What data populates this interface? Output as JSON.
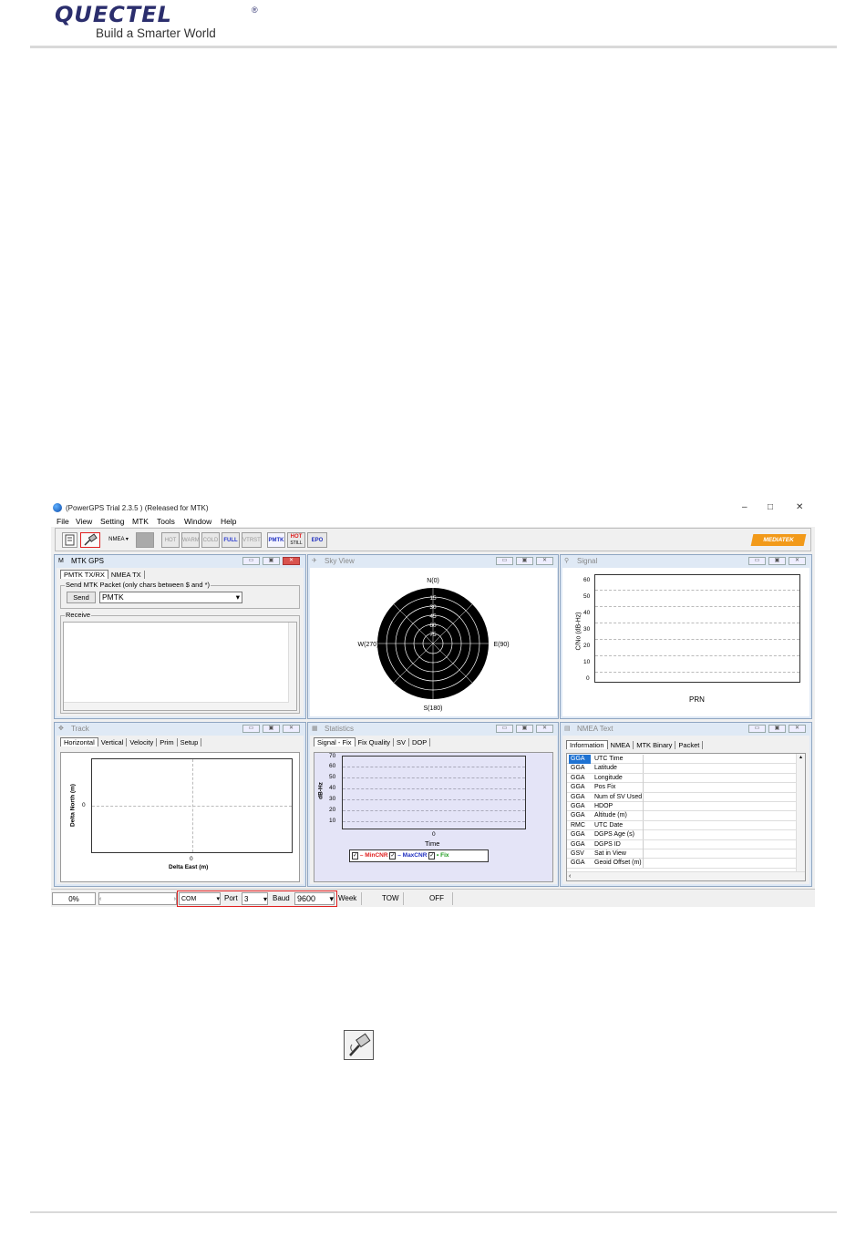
{
  "header": {
    "logo_word": "QUECTEL",
    "logo_reg": "®",
    "tagline": "Build a Smarter World"
  },
  "app": {
    "title": "(PowerGPS Trial 2.3.5 ) (Released for MTK)",
    "window_controls": [
      "–",
      "□",
      "✕"
    ],
    "menu": [
      "File",
      "View",
      "Setting",
      "MTK",
      "Tools",
      "Window",
      "Help"
    ],
    "toolbar": {
      "nmea": "NMEA",
      "hot": "HOT",
      "warm": "WARM",
      "cold": "COLD",
      "full": "FULL",
      "vtrst": "VTRST",
      "pmtk": "PMTK",
      "hot_still": "HOT",
      "still": "STILL",
      "epo": "EPO",
      "brand": "MEDIATEK"
    },
    "mtk_gps": {
      "title": "MTK GPS",
      "tabs": [
        "PMTK TX/RX",
        "NMEA TX"
      ],
      "send_group": "Send MTK Packet (only chars between $ and *)",
      "send_button": "Send",
      "packet_value": "PMTK",
      "receive_group": "Receive"
    },
    "sky_view": {
      "title": "Sky View",
      "north": "N(0)",
      "east": "E(90)",
      "south": "S(180)",
      "west": "W(270)",
      "rings": [
        "15",
        "30",
        "45",
        "60",
        "75"
      ]
    },
    "signal": {
      "title": "Signal",
      "ylabel": "C/No (dB-Hz)",
      "xlabel": "PRN",
      "yticks": [
        "60",
        "50",
        "40",
        "30",
        "20",
        "10",
        "0"
      ]
    },
    "track": {
      "title": "Track",
      "tabs": [
        "Horizontal",
        "Vertical",
        "Velocity",
        "Prim",
        "Setup"
      ],
      "ylabel": "Delta North (m)",
      "xlabel": "Delta East (m)",
      "zero_x": "0",
      "zero_y": "0"
    },
    "statistics": {
      "title": "Statistics",
      "tabs": [
        "Signal - Fix",
        "Fix Quality",
        "SV",
        "DOP"
      ],
      "ylabel": "dB-Hz",
      "xlabel": "Time",
      "zero_x": "0",
      "yticks": [
        "70",
        "60",
        "50",
        "40",
        "30",
        "20",
        "10"
      ],
      "legend": [
        {
          "label": "MinCNR",
          "color": "#e02020"
        },
        {
          "label": "MaxCNR",
          "color": "#2030c0"
        },
        {
          "label": "Fix",
          "color": "#1a9a1a"
        }
      ]
    },
    "nmea_text": {
      "title": "NMEA Text",
      "tabs": [
        "Information",
        "NMEA",
        "MTK Binary",
        "Packet"
      ],
      "rows": [
        {
          "type": "GGA",
          "field": "UTC Time"
        },
        {
          "type": "GGA",
          "field": "Latitude"
        },
        {
          "type": "GGA",
          "field": "Longitude"
        },
        {
          "type": "GGA",
          "field": "Pos Fix"
        },
        {
          "type": "GGA",
          "field": "Num of SV Used"
        },
        {
          "type": "GGA",
          "field": "HDOP"
        },
        {
          "type": "GGA",
          "field": "Altitude (m)"
        },
        {
          "type": "RMC",
          "field": "UTC Date"
        },
        {
          "type": "GGA",
          "field": "DGPS Age (s)"
        },
        {
          "type": "GGA",
          "field": "DGPS ID"
        },
        {
          "type": "GSV",
          "field": "Sat in View"
        },
        {
          "type": "GGA",
          "field": "Geoid Offset (m)"
        }
      ]
    },
    "status": {
      "progress": "0%",
      "progress_value": 0,
      "com": "COM",
      "port_label": "Port",
      "port": "3",
      "baud_label": "Baud",
      "baud": "9600",
      "week": "Week",
      "tow": "TOW",
      "off": "OFF"
    }
  }
}
